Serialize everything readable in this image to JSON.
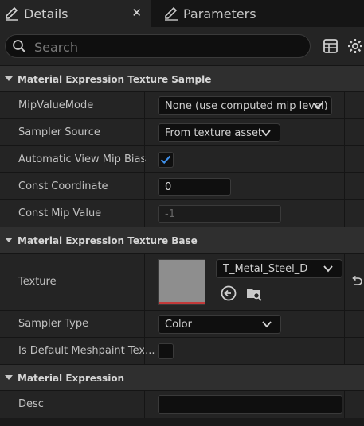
{
  "tabs": {
    "details_label": "Details",
    "close_glyph": "✕",
    "parameters_label": "Parameters"
  },
  "search": {
    "placeholder": "Search"
  },
  "sections": [
    {
      "title": "Material Expression Texture Sample"
    },
    {
      "title": "Material Expression Texture Base"
    },
    {
      "title": "Material Expression"
    }
  ],
  "rows": {
    "mip_value_mode": {
      "label": "MipValueMode",
      "value": "None (use computed mip level)"
    },
    "sampler_source": {
      "label": "Sampler Source",
      "value": "From texture asset"
    },
    "auto_view_mip_bias": {
      "label": "Automatic View Mip Bias",
      "checked": true
    },
    "const_coordinate": {
      "label": "Const Coordinate",
      "value": "0"
    },
    "const_mip_value": {
      "label": "Const Mip Value",
      "value": "-1"
    },
    "texture": {
      "label": "Texture",
      "asset": "T_Metal_Steel_D"
    },
    "sampler_type": {
      "label": "Sampler Type",
      "value": "Color"
    },
    "is_default_meshpaint": {
      "label": "Is Default Meshpaint Tex...",
      "checked": false
    },
    "desc": {
      "label": "Desc",
      "value": ""
    }
  },
  "icons": {
    "details_tab": "pencil-icon",
    "parameters_tab": "pencil-icon",
    "search": "search-icon",
    "table_view": "table-icon",
    "settings": "gear-icon",
    "use_asset": "arrow-left-circle-icon",
    "browse": "folder-search-icon",
    "reset": "reset-arrow-icon",
    "dropdown": "chevron-down-icon"
  },
  "colors": {
    "checkmark": "#3f8fe8",
    "texture_strip": "#c23a3a"
  }
}
